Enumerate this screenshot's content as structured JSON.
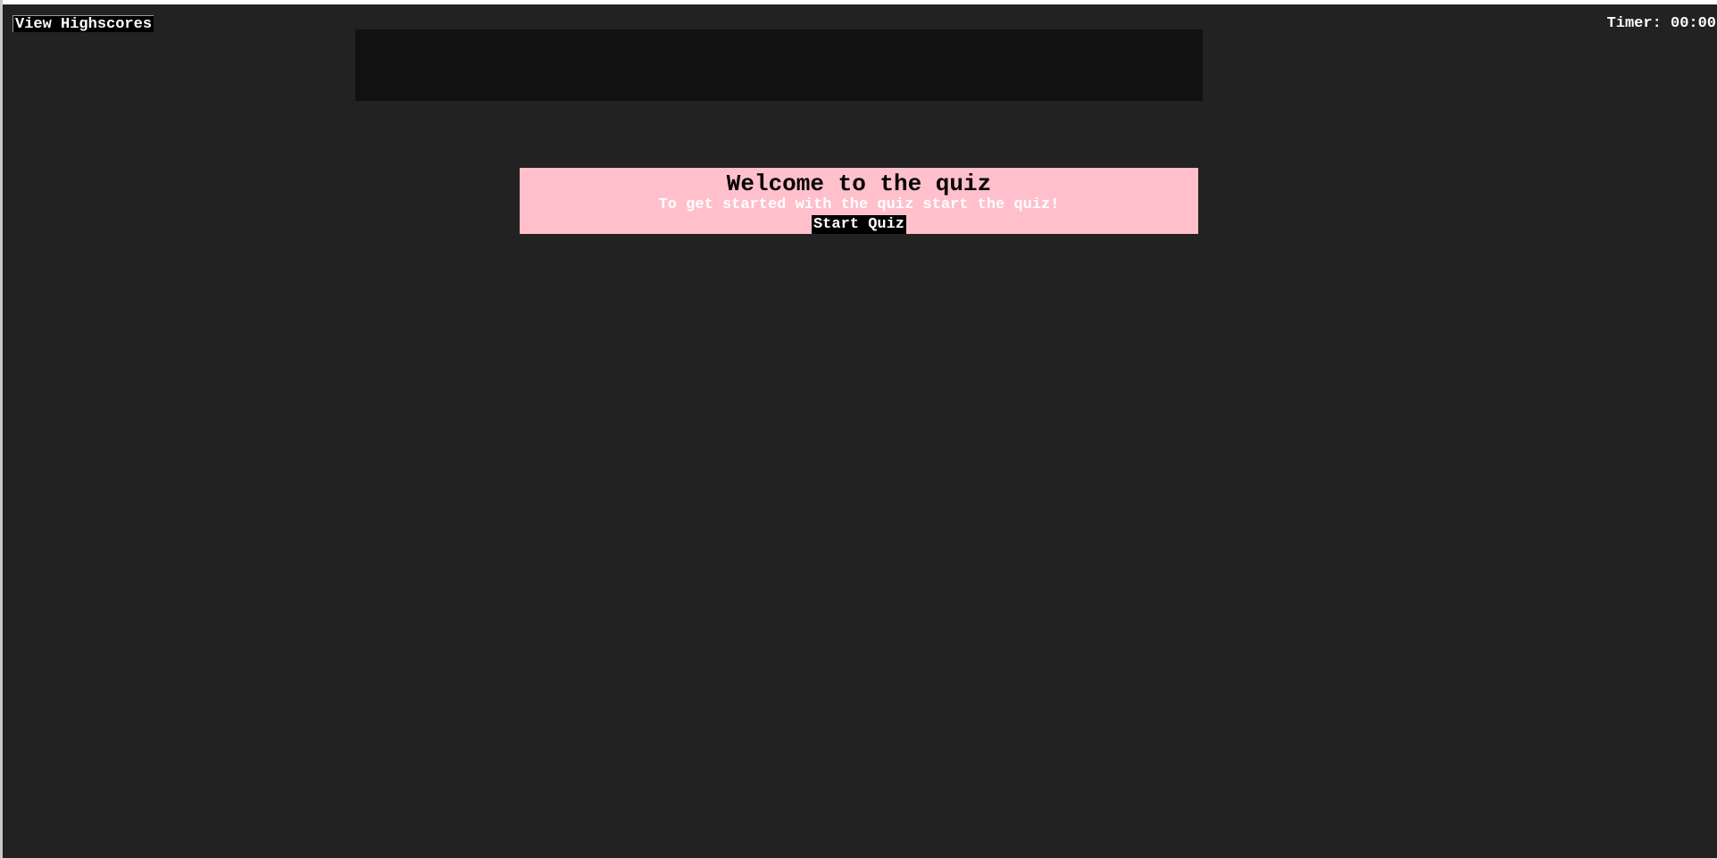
{
  "header": {
    "highscores_label": "View Highscores",
    "timer_text": "Timer: 00:00"
  },
  "welcome": {
    "title": "Welcome to the quiz",
    "subtitle": "To get started with the quiz start the quiz!",
    "start_label": "Start Quiz"
  },
  "colors": {
    "background": "#222222",
    "banner": "#111111",
    "card": "#ffc0cb",
    "button_bg": "#000000",
    "text_light": "#ffffff",
    "text_dark": "#000000"
  }
}
